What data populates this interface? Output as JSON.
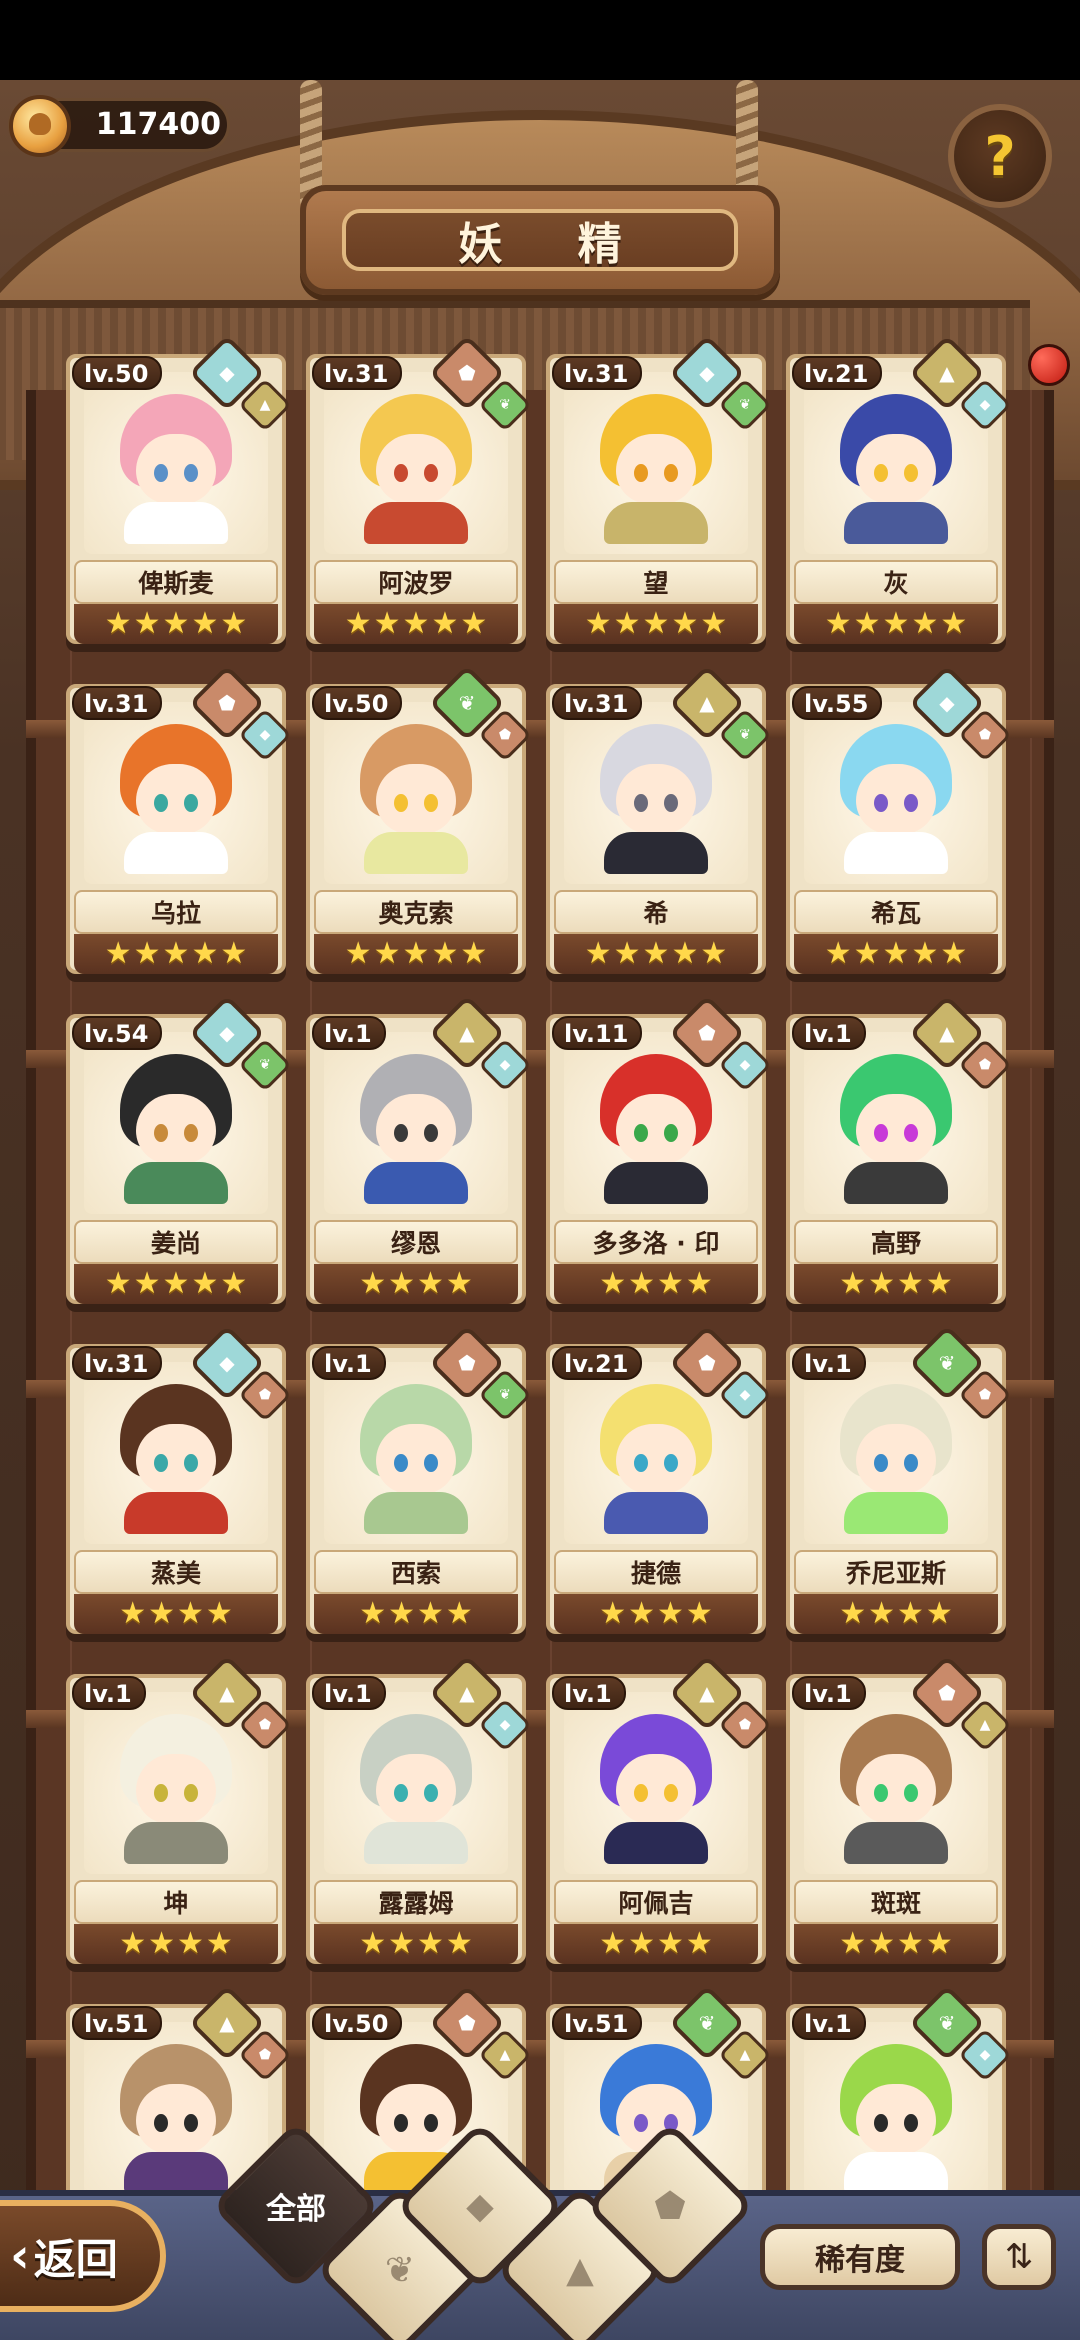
{
  "header": {
    "title": "妖 精",
    "currency_value": "117400"
  },
  "bottom_bar": {
    "back_label": "返回",
    "filter_all_label": "全部",
    "sort_label": "稀有度"
  },
  "colors": {
    "water": "#9ed8d8",
    "earth": "#c9b56a",
    "plant": "#7cc46a",
    "fire": "#c98a6a",
    "star": "#ffd84a"
  },
  "cards": [
    {
      "name": "俾斯麦",
      "level": "lv.50",
      "stars": 5,
      "hair": "#f4a6b8",
      "outfit": "#ffffff",
      "eye": "#5a90c8",
      "badges": [
        "water",
        "earth"
      ]
    },
    {
      "name": "阿波罗",
      "level": "lv.31",
      "stars": 5,
      "hair": "#f4c850",
      "outfit": "#c84a30",
      "eye": "#c84a30",
      "badges": [
        "fire",
        "plant"
      ]
    },
    {
      "name": "望",
      "level": "lv.31",
      "stars": 5,
      "hair": "#f4c032",
      "outfit": "#c8b46a",
      "eye": "#e89a20",
      "badges": [
        "water",
        "plant"
      ]
    },
    {
      "name": "灰",
      "level": "lv.21",
      "stars": 5,
      "hair": "#3a4aa8",
      "outfit": "#4a5a9a",
      "eye": "#f4c032",
      "badges": [
        "earth",
        "water"
      ]
    },
    {
      "name": "乌拉",
      "level": "lv.31",
      "stars": 5,
      "hair": "#e8742a",
      "outfit": "#ffffff",
      "eye": "#3aa8a0",
      "badges": [
        "fire",
        "water"
      ]
    },
    {
      "name": "奥克索",
      "level": "lv.50",
      "stars": 5,
      "hair": "#d89a64",
      "outfit": "#e8e8a0",
      "eye": "#f4c032",
      "badges": [
        "plant",
        "fire"
      ]
    },
    {
      "name": "希",
      "level": "lv.31",
      "stars": 5,
      "hair": "#d8d8e0",
      "outfit": "#2a2a34",
      "eye": "#6a6a7a",
      "badges": [
        "earth",
        "plant"
      ]
    },
    {
      "name": "希瓦",
      "level": "lv.55",
      "stars": 5,
      "hair": "#8ad8f0",
      "outfit": "#ffffff",
      "eye": "#7a5ac8",
      "badges": [
        "water",
        "fire"
      ]
    },
    {
      "name": "姜尚",
      "level": "lv.54",
      "stars": 5,
      "hair": "#2a2a2a",
      "outfit": "#4a8a5a",
      "eye": "#c88a3a",
      "badges": [
        "water",
        "plant"
      ]
    },
    {
      "name": "缪恩",
      "level": "lv.1",
      "stars": 4,
      "hair": "#b0b0b4",
      "outfit": "#3a5ab0",
      "eye": "#3a3a3a",
      "badges": [
        "earth",
        "water"
      ]
    },
    {
      "name": "多多洛 · 印",
      "level": "lv.11",
      "stars": 4,
      "hair": "#d8302a",
      "outfit": "#2a2a34",
      "eye": "#3aa84a",
      "badges": [
        "fire",
        "water"
      ]
    },
    {
      "name": "高野",
      "level": "lv.1",
      "stars": 4,
      "hair": "#3ac870",
      "outfit": "#3a3a3a",
      "eye": "#c83ad8",
      "badges": [
        "earth",
        "fire"
      ]
    },
    {
      "name": "蒸美",
      "level": "lv.31",
      "stars": 4,
      "hair": "#5a3420",
      "outfit": "#c83a2a",
      "eye": "#3aa8a8",
      "badges": [
        "water",
        "fire"
      ]
    },
    {
      "name": "西索",
      "level": "lv.1",
      "stars": 4,
      "hair": "#b8d8a8",
      "outfit": "#a8c890",
      "eye": "#3a8ac8",
      "badges": [
        "fire",
        "plant"
      ]
    },
    {
      "name": "捷德",
      "level": "lv.21",
      "stars": 4,
      "hair": "#f4e070",
      "outfit": "#4a5ab0",
      "eye": "#3aa8c8",
      "badges": [
        "fire",
        "water"
      ]
    },
    {
      "name": "乔尼亚斯",
      "level": "lv.1",
      "stars": 4,
      "hair": "#e8e4cc",
      "outfit": "#9ae874",
      "eye": "#3a8ac8",
      "badges": [
        "plant",
        "fire"
      ]
    },
    {
      "name": "坤",
      "level": "lv.1",
      "stars": 4,
      "hair": "#f4f0e0",
      "outfit": "#8a8a78",
      "eye": "#c8b43a",
      "badges": [
        "earth",
        "fire"
      ]
    },
    {
      "name": "露露姆",
      "level": "lv.1",
      "stars": 4,
      "hair": "#c8d0c4",
      "outfit": "#e0e4d8",
      "eye": "#3ab0b0",
      "badges": [
        "earth",
        "water"
      ]
    },
    {
      "name": "阿佩吉",
      "level": "lv.1",
      "stars": 4,
      "hair": "#7a4ad8",
      "outfit": "#2a2a54",
      "eye": "#f4c032",
      "badges": [
        "earth",
        "fire"
      ]
    },
    {
      "name": "斑斑",
      "level": "lv.1",
      "stars": 4,
      "hair": "#a87a50",
      "outfit": "#5a5a5a",
      "eye": "#3ac870",
      "badges": [
        "fire",
        "earth"
      ]
    },
    {
      "name": "",
      "level": "lv.51",
      "stars": 0,
      "hair": "#b8926a",
      "outfit": "#5a3a7a",
      "eye": "#2a2a2a",
      "badges": [
        "earth",
        "fire"
      ]
    },
    {
      "name": "",
      "level": "lv.50",
      "stars": 0,
      "hair": "#5a3420",
      "outfit": "#f4c032",
      "eye": "#2a2a2a",
      "badges": [
        "fire",
        "earth"
      ]
    },
    {
      "name": "",
      "level": "lv.51",
      "stars": 0,
      "hair": "#3a7ad8",
      "outfit": "#e8d0a8",
      "eye": "#7a5ac8",
      "badges": [
        "plant",
        "earth"
      ]
    },
    {
      "name": "",
      "level": "lv.1",
      "stars": 0,
      "hair": "#9ad84a",
      "outfit": "#ffffff",
      "eye": "#2a2a2a",
      "badges": [
        "plant",
        "water"
      ]
    }
  ]
}
